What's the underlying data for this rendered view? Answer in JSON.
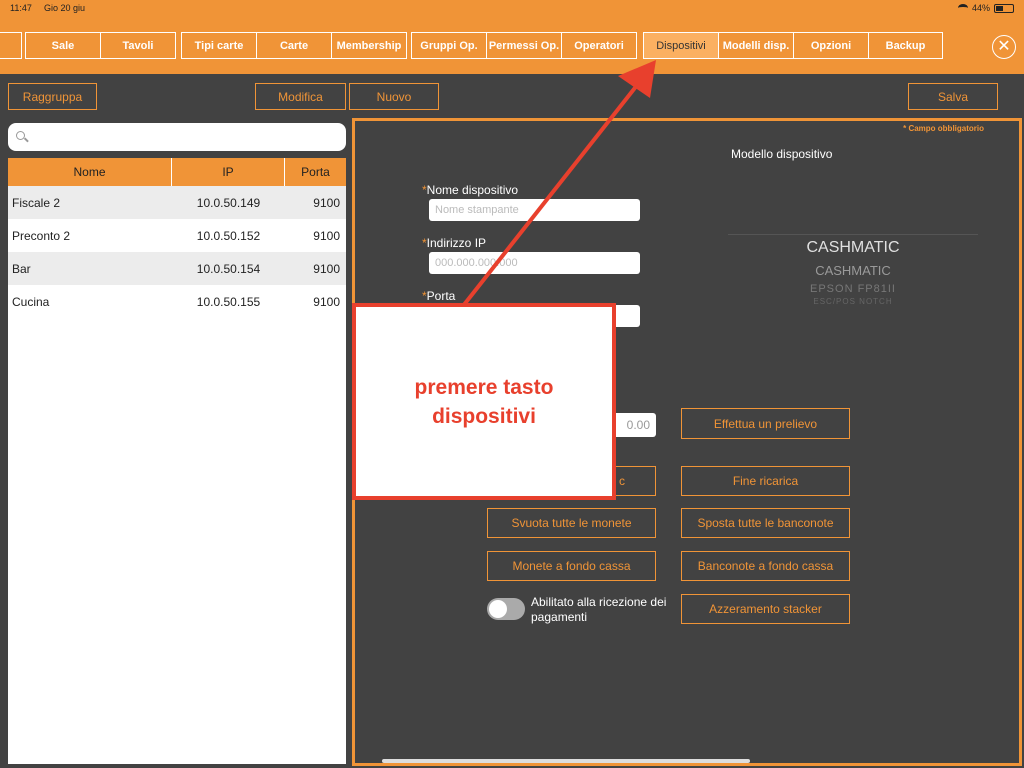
{
  "status": {
    "time": "11:47",
    "date": "Gio 20 giu",
    "battery": "44%",
    "battery_level": 0.44
  },
  "tabs": [
    {
      "label": "Sale",
      "active": false
    },
    {
      "label": "Tavoli",
      "active": false
    },
    {
      "label": "Tipi carte",
      "active": false
    },
    {
      "label": "Carte",
      "active": false
    },
    {
      "label": "Membership",
      "active": false
    },
    {
      "label": "Gruppi Op.",
      "active": false
    },
    {
      "label": "Permessi Op.",
      "active": false
    },
    {
      "label": "Operatori",
      "active": false
    },
    {
      "label": "Dispositivi",
      "active": true
    },
    {
      "label": "Modelli disp.",
      "active": false
    },
    {
      "label": "Opzioni",
      "active": false
    },
    {
      "label": "Backup",
      "active": false
    }
  ],
  "toolbar": {
    "group": "Raggruppa",
    "edit": "Modifica",
    "new": "Nuovo",
    "save": "Salva"
  },
  "table": {
    "headers": [
      "Nome",
      "IP",
      "Porta"
    ],
    "rows": [
      [
        "Fiscale 2",
        "10.0.50.149",
        "9100"
      ],
      [
        "Preconto 2",
        "10.0.50.152",
        "9100"
      ],
      [
        "Bar",
        "10.0.50.154",
        "9100"
      ],
      [
        "Cucina",
        "10.0.50.155",
        "9100"
      ]
    ]
  },
  "form": {
    "required_note": "* Campo obbligatorio",
    "model_title": "Modello dispositivo",
    "required_mark": "*",
    "name_label": "Nome dispositivo",
    "name_placeholder": "Nome stampante",
    "ip_label": "Indirizzo IP",
    "ip_placeholder": "000.000.000.000",
    "port_label": "Porta"
  },
  "printer": {
    "line1": "CASHMATIC",
    "line2": "CASHMATIC",
    "line3": "EPSON FP81II",
    "line4": "ESC/POS NOTCH"
  },
  "cash": {
    "amount": "0.00",
    "withdraw": "Effettua un prelievo",
    "partial_left": "c",
    "end_reload": "Fine ricarica",
    "empty_coins": "Svuota tutte le monete",
    "move_notes": "Sposta tutte le banconote",
    "coins_base": "Monete a fondo cassa",
    "notes_base": "Banconote a fondo cassa",
    "reset_stacker": "Azzeramento stacker",
    "payments_toggle_label": "Abilitato alla ricezione dei pagamenti",
    "payments_enabled": false
  },
  "callout": {
    "text": "premere tasto dispositivi"
  },
  "colors": {
    "accent": "#f09437",
    "background": "#424242",
    "callout": "#e8402d"
  },
  "icons": {
    "close": "close-icon",
    "search": "search-icon",
    "wifi": "wifi-icon",
    "battery": "battery-icon"
  }
}
